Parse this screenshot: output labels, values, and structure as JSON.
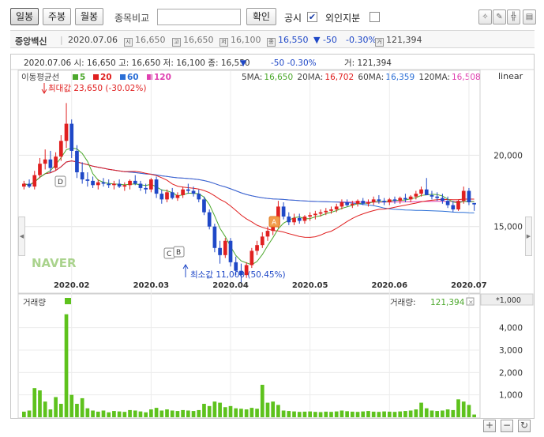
{
  "toolbar": {
    "daily": "일봉",
    "weekly": "주봉",
    "monthly": "월봉",
    "compare_label": "종목비교",
    "confirm": "확인",
    "disclosure": "공시",
    "disclosure_check": "✔",
    "foreign": "외인지분"
  },
  "stock": {
    "name": "중앙백신",
    "date": "2020.07.06",
    "open_icon": "시",
    "open": "16,650",
    "high_icon": "고",
    "high": "16,650",
    "low_icon": "저",
    "low": "16,100",
    "close_icon": "종",
    "close": "16,550",
    "change": "▼ -50",
    "change_pct": "-0.30%",
    "volume_icon": "거",
    "volume": "121,394"
  },
  "chart_header": {
    "line": "2020.07.06 시: 16,650  고: 16,650  저: 16,100  종: 16,550",
    "arrow": "▼",
    "change": "-50  -0.30%",
    "volume": "거: 121,394"
  },
  "ma_legend": {
    "title": "이동평균선",
    "items": [
      {
        "label": "5",
        "color": "#4ca82c"
      },
      {
        "label": "20",
        "color": "#e02020"
      },
      {
        "label": "60",
        "color": "#2b6fd6"
      },
      {
        "label": "120",
        "color": "#e040b0"
      }
    ],
    "values": [
      {
        "label": "5MA:",
        "value": "16,650",
        "color": "#4ca82c"
      },
      {
        "label": "20MA:",
        "value": "16,702",
        "color": "#e02020"
      },
      {
        "label": "60MA:",
        "value": "16,359",
        "color": "#2b6fd6"
      },
      {
        "label": "120MA:",
        "value": "16,508",
        "color": "#e040b0"
      }
    ]
  },
  "scale_mode": "linear",
  "annotations": {
    "max": "최대값 23,650 (-30.02%)",
    "min": "최소값 11,000 (50.45%)",
    "markers": [
      "D",
      "C",
      "B",
      "A"
    ]
  },
  "watermark": "NAVER",
  "volume_panel": {
    "title": "거래량",
    "label": "거래량:",
    "value": "121,394",
    "unit": "*1,000"
  },
  "colors": {
    "up": "#e02020",
    "down": "#1f48c7",
    "volume": "#5ec21d",
    "ma5": "#4ca82c",
    "ma20": "#e02020",
    "ma60": "#2b6fd6",
    "ma120": "#e040b0"
  },
  "chart_data": {
    "type": "candlestick",
    "x_ticks": [
      "2020.02",
      "2020.03",
      "2020.04",
      "2020.05",
      "2020.06",
      "2020.07"
    ],
    "price_ticks": [
      "20,000",
      "15,000"
    ],
    "price_tick_values": [
      20000,
      15000
    ],
    "volume_ticks": [
      "4,000",
      "3,000",
      "2,000",
      "1,000"
    ],
    "volume_tick_values": [
      4000,
      3000,
      2000,
      1000
    ],
    "price_range": [
      10500,
      25000
    ],
    "volume_range": [
      0,
      4800
    ],
    "candles": [
      [
        17800,
        18200,
        17600,
        18000
      ],
      [
        18000,
        18300,
        17700,
        17800
      ],
      [
        17800,
        18900,
        17600,
        18600
      ],
      [
        18600,
        19800,
        18400,
        19400
      ],
      [
        19400,
        20400,
        19000,
        19700
      ],
      [
        19700,
        20300,
        18800,
        19100
      ],
      [
        19100,
        20200,
        18900,
        19900
      ],
      [
        19900,
        21400,
        19600,
        21000
      ],
      [
        21000,
        23650,
        20500,
        22200
      ],
      [
        22200,
        22500,
        19800,
        20300
      ],
      [
        20300,
        20700,
        18400,
        18800
      ],
      [
        18800,
        19500,
        18000,
        18300
      ],
      [
        18300,
        18800,
        17800,
        18200
      ],
      [
        18200,
        18500,
        17700,
        17900
      ],
      [
        17900,
        18300,
        17600,
        18100
      ],
      [
        18100,
        18400,
        17800,
        18000
      ],
      [
        18000,
        18300,
        17700,
        17900
      ],
      [
        17900,
        18200,
        17600,
        18000
      ],
      [
        18000,
        18300,
        17700,
        17800
      ],
      [
        17800,
        18100,
        17500,
        17900
      ],
      [
        17900,
        18300,
        17600,
        18200
      ],
      [
        18200,
        18600,
        17900,
        18000
      ],
      [
        18000,
        18200,
        17500,
        17700
      ],
      [
        17700,
        18000,
        17300,
        17600
      ],
      [
        17600,
        18400,
        17400,
        18300
      ],
      [
        18300,
        18500,
        17000,
        17300
      ],
      [
        17300,
        17600,
        16600,
        16900
      ],
      [
        16900,
        17600,
        16700,
        17400
      ],
      [
        17400,
        17700,
        16900,
        17000
      ],
      [
        17000,
        17400,
        16800,
        17200
      ],
      [
        17200,
        17800,
        17000,
        17600
      ],
      [
        17600,
        18000,
        17300,
        17500
      ],
      [
        17500,
        17800,
        17100,
        17300
      ],
      [
        17300,
        17600,
        16700,
        16900
      ],
      [
        16900,
        17100,
        15800,
        16000
      ],
      [
        16000,
        16200,
        14800,
        15000
      ],
      [
        15000,
        15200,
        13200,
        13500
      ],
      [
        13500,
        14000,
        12400,
        13000
      ],
      [
        13000,
        14200,
        12800,
        14000
      ],
      [
        14000,
        14200,
        12200,
        12500
      ],
      [
        12500,
        12900,
        11600,
        11900
      ],
      [
        11900,
        12400,
        11000,
        11600
      ],
      [
        11600,
        12500,
        11400,
        12300
      ],
      [
        12300,
        13500,
        12100,
        13300
      ],
      [
        13300,
        14000,
        13000,
        13700
      ],
      [
        13700,
        14600,
        13500,
        14300
      ],
      [
        14300,
        15000,
        14000,
        14700
      ],
      [
        14700,
        15400,
        14400,
        15100
      ],
      [
        15100,
        16800,
        14900,
        16400
      ],
      [
        16400,
        16700,
        15500,
        15700
      ],
      [
        15700,
        16000,
        15100,
        15300
      ],
      [
        15300,
        15900,
        15100,
        15600
      ],
      [
        15600,
        15900,
        15200,
        15400
      ],
      [
        15400,
        15800,
        15200,
        15700
      ],
      [
        15700,
        16000,
        15400,
        15800
      ],
      [
        15800,
        16100,
        15500,
        15900
      ],
      [
        15900,
        16200,
        15700,
        16000
      ],
      [
        16000,
        16300,
        15800,
        16100
      ],
      [
        16100,
        16400,
        15900,
        16200
      ],
      [
        16200,
        16600,
        16000,
        16400
      ],
      [
        16400,
        16900,
        16200,
        16700
      ],
      [
        16700,
        16900,
        16400,
        16500
      ],
      [
        16500,
        16800,
        16300,
        16600
      ],
      [
        16600,
        16900,
        16400,
        16800
      ],
      [
        16800,
        17000,
        16500,
        16600
      ],
      [
        16600,
        16900,
        16400,
        16700
      ],
      [
        16700,
        17100,
        16500,
        16900
      ],
      [
        16900,
        17200,
        16600,
        16800
      ],
      [
        16800,
        17000,
        16500,
        16700
      ],
      [
        16700,
        17000,
        16500,
        16900
      ],
      [
        16900,
        17100,
        16600,
        16800
      ],
      [
        16800,
        17100,
        16600,
        17000
      ],
      [
        17000,
        17300,
        16700,
        16900
      ],
      [
        16900,
        17200,
        16700,
        17100
      ],
      [
        17100,
        17500,
        16900,
        17300
      ],
      [
        17300,
        17800,
        17100,
        17600
      ],
      [
        17600,
        18400,
        17400,
        17200
      ],
      [
        17200,
        17500,
        16900,
        17100
      ],
      [
        17100,
        17400,
        16800,
        17000
      ],
      [
        17000,
        17300,
        16600,
        16800
      ],
      [
        16800,
        17100,
        16300,
        16500
      ],
      [
        16500,
        16800,
        16000,
        16200
      ],
      [
        16200,
        16900,
        16100,
        16800
      ],
      [
        16800,
        17800,
        16600,
        17500
      ],
      [
        17500,
        17700,
        16500,
        16700
      ],
      [
        16650,
        16650,
        16100,
        16550
      ]
    ],
    "volume": [
      250,
      300,
      1300,
      1200,
      700,
      350,
      900,
      600,
      4600,
      1000,
      600,
      850,
      400,
      300,
      250,
      300,
      220,
      280,
      260,
      240,
      320,
      300,
      260,
      220,
      350,
      420,
      300,
      350,
      300,
      280,
      320,
      300,
      280,
      320,
      600,
      500,
      700,
      650,
      450,
      500,
      400,
      380,
      350,
      420,
      380,
      1450,
      650,
      700,
      550,
      300,
      280,
      260,
      240,
      250,
      260,
      240,
      230,
      250,
      240,
      260,
      300,
      270,
      250,
      240,
      260,
      280,
      250,
      240,
      260,
      250,
      240,
      260,
      280,
      300,
      350,
      650,
      400,
      300,
      280,
      300,
      350,
      320,
      800,
      700,
      550,
      121
    ]
  }
}
